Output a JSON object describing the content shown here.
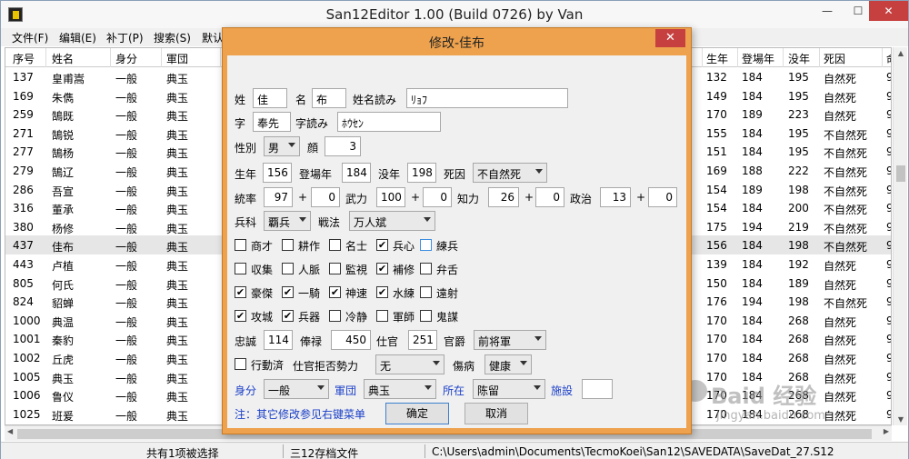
{
  "window": {
    "title": "San12Editor 1.00 (Build 0726) by Van",
    "min_glyph": "—",
    "max_glyph": "☐",
    "close_glyph": "✕",
    "menu": [
      "文件(F)",
      "编辑(E)",
      "补丁(P)",
      "搜索(S)",
      "默认"
    ]
  },
  "table": {
    "columns_left": [
      "序号",
      "姓名",
      "身分",
      "軍団"
    ],
    "columns_right": [
      "生年",
      "登場年",
      "没年",
      "死因",
      "命"
    ],
    "rows": [
      {
        "no": "137",
        "name": "皇甫嵩",
        "rank": "一般",
        "corps": "典玉",
        "birth": "132",
        "appear": "184",
        "death": "195",
        "cause": "自然死",
        "x": "9"
      },
      {
        "no": "169",
        "name": "朱儁",
        "rank": "一般",
        "corps": "典玉",
        "birth": "149",
        "appear": "184",
        "death": "195",
        "cause": "自然死",
        "x": "9"
      },
      {
        "no": "259",
        "name": "鵠既",
        "rank": "一般",
        "corps": "典玉",
        "birth": "170",
        "appear": "189",
        "death": "223",
        "cause": "自然死",
        "x": "9"
      },
      {
        "no": "271",
        "name": "鵠锐",
        "rank": "一般",
        "corps": "典玉",
        "birth": "155",
        "appear": "184",
        "death": "195",
        "cause": "不自然死",
        "x": "9"
      },
      {
        "no": "277",
        "name": "鵠杨",
        "rank": "一般",
        "corps": "典玉",
        "birth": "151",
        "appear": "184",
        "death": "195",
        "cause": "不自然死",
        "x": "9"
      },
      {
        "no": "279",
        "name": "鵠辽",
        "rank": "一般",
        "corps": "典玉",
        "birth": "169",
        "appear": "188",
        "death": "222",
        "cause": "不自然死",
        "x": "9"
      },
      {
        "no": "286",
        "name": "吾宣",
        "rank": "一般",
        "corps": "典玉",
        "birth": "154",
        "appear": "189",
        "death": "198",
        "cause": "不自然死",
        "x": "9"
      },
      {
        "no": "316",
        "name": "董承",
        "rank": "一般",
        "corps": "典玉",
        "birth": "154",
        "appear": "184",
        "death": "200",
        "cause": "不自然死",
        "x": "9"
      },
      {
        "no": "380",
        "name": "杨修",
        "rank": "一般",
        "corps": "典玉",
        "birth": "175",
        "appear": "194",
        "death": "219",
        "cause": "不自然死",
        "x": "9"
      },
      {
        "no": "437",
        "name": "佳布",
        "rank": "一般",
        "corps": "典玉",
        "birth": "156",
        "appear": "184",
        "death": "198",
        "cause": "不自然死",
        "x": "9"
      },
      {
        "no": "443",
        "name": "卢植",
        "rank": "一般",
        "corps": "典玉",
        "birth": "139",
        "appear": "184",
        "death": "192",
        "cause": "自然死",
        "x": "9"
      },
      {
        "no": "805",
        "name": "何氏",
        "rank": "一般",
        "corps": "典玉",
        "birth": "150",
        "appear": "184",
        "death": "189",
        "cause": "自然死",
        "x": "9"
      },
      {
        "no": "824",
        "name": "貂蝉",
        "rank": "一般",
        "corps": "典玉",
        "birth": "176",
        "appear": "194",
        "death": "198",
        "cause": "不自然死",
        "x": "9"
      },
      {
        "no": "1000",
        "name": "典温",
        "rank": "一般",
        "corps": "典玉",
        "birth": "170",
        "appear": "184",
        "death": "268",
        "cause": "自然死",
        "x": "9"
      },
      {
        "no": "1001",
        "name": "秦豹",
        "rank": "一般",
        "corps": "典玉",
        "birth": "170",
        "appear": "184",
        "death": "268",
        "cause": "自然死",
        "x": "9"
      },
      {
        "no": "1002",
        "name": "丘虎",
        "rank": "一般",
        "corps": "典玉",
        "birth": "170",
        "appear": "184",
        "death": "268",
        "cause": "自然死",
        "x": "9"
      },
      {
        "no": "1005",
        "name": "典玉",
        "rank": "一般",
        "corps": "典玉",
        "birth": "170",
        "appear": "184",
        "death": "268",
        "cause": "自然死",
        "x": "9"
      },
      {
        "no": "1006",
        "name": "鲁仪",
        "rank": "一般",
        "corps": "典玉",
        "birth": "170",
        "appear": "184",
        "death": "268",
        "cause": "自然死",
        "x": "9"
      },
      {
        "no": "1025",
        "name": "班爰",
        "rank": "一般",
        "corps": "典玉",
        "birth": "170",
        "appear": "184",
        "death": "268",
        "cause": "自然死",
        "x": "9"
      }
    ]
  },
  "status": {
    "selection": "共有1项被选择",
    "filetype": "三12存档文件",
    "path": "C:\\Users\\admin\\Documents\\TecmoKoei\\San12\\SAVEDATA\\SaveDat_27.S12"
  },
  "dialog": {
    "title": "修改-佳布",
    "close_glyph": "✕",
    "labels": {
      "surname": "姓",
      "given": "名",
      "reading": "姓名読み",
      "style": "字",
      "style_reading": "字読み",
      "gender": "性別",
      "face": "顔",
      "birth": "生年",
      "appear": "登場年",
      "death": "没年",
      "cause": "死因",
      "lead": "統率",
      "war": "武力",
      "int": "知力",
      "pol": "政治",
      "plus": "+",
      "troop": "兵科",
      "tactic": "戦法",
      "loyalty": "忠誠",
      "salary": "俸禄",
      "serve": "仕官",
      "title": "官爵",
      "refuse": "仕官拒否勢力",
      "disease": "傷病",
      "rank": "身分",
      "corps": "軍団",
      "location": "所在",
      "facility": "施設",
      "note": "注：其它修改参见右键菜单"
    },
    "values": {
      "surname": "佳",
      "given": "布",
      "reading": "ﾘｮﾌ",
      "style": "奉先",
      "style_reading": "ﾎｳｾﾝ",
      "gender": "男",
      "face": "3",
      "birth": "156",
      "appear": "184",
      "death": "198",
      "cause": "不自然死",
      "lead": "97",
      "lead_plus": "0",
      "war": "100",
      "war_plus": "0",
      "int": "26",
      "int_plus": "0",
      "pol": "13",
      "pol_plus": "0",
      "troop": "覇兵",
      "tactic": "万人斌",
      "loyalty": "114",
      "salary": "450",
      "serve": "251",
      "title": "前将軍",
      "refuse": "无",
      "disease": "健康",
      "rank": "一般",
      "corps": "典玉",
      "location": "陈留",
      "facility": ""
    },
    "skills": [
      {
        "label": "商才",
        "checked": false
      },
      {
        "label": "耕作",
        "checked": false
      },
      {
        "label": "名士",
        "checked": false
      },
      {
        "label": "兵心",
        "checked": true
      },
      {
        "label": "練兵",
        "checked": false
      },
      {
        "label": "収集",
        "checked": false
      },
      {
        "label": "人脈",
        "checked": false
      },
      {
        "label": "監視",
        "checked": false
      },
      {
        "label": "補修",
        "checked": true
      },
      {
        "label": "弁舌",
        "checked": false
      },
      {
        "label": "豪傑",
        "checked": true
      },
      {
        "label": "一騎",
        "checked": true
      },
      {
        "label": "神速",
        "checked": true
      },
      {
        "label": "水練",
        "checked": true
      },
      {
        "label": "遠射",
        "checked": false
      },
      {
        "label": "攻城",
        "checked": true
      },
      {
        "label": "兵器",
        "checked": true
      },
      {
        "label": "冷静",
        "checked": false
      },
      {
        "label": "軍師",
        "checked": false
      },
      {
        "label": "鬼謀",
        "checked": false
      }
    ],
    "action_label": "行動済",
    "action_checked": false,
    "ok_label": "确定",
    "cancel_label": "取消"
  },
  "watermark": {
    "big": "Baid 经验",
    "small": "jingyan.baidu.com"
  }
}
